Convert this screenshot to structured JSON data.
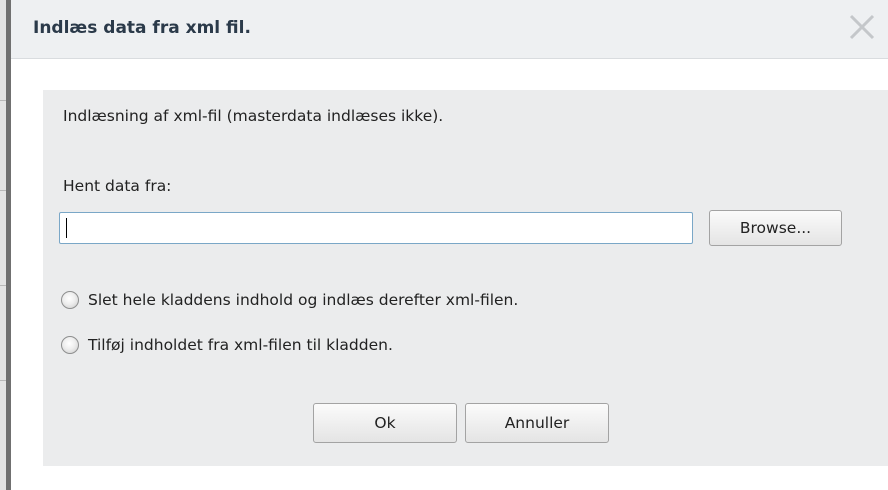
{
  "dialog": {
    "title": "Indlæs data fra xml fil.",
    "close_icon": "close-x-icon",
    "intro": "Indlæsning af xml-fil (masterdata indlæses ikke).",
    "file_label": "Hent data fra:",
    "file_input": {
      "value": "",
      "placeholder": ""
    },
    "browse_label": "Browse...",
    "options": [
      {
        "label": "Slet hele kladdens indhold og indlæs derefter xml-filen.",
        "selected": false
      },
      {
        "label": "Tilføj indholdet fra xml-filen til kladden.",
        "selected": false
      }
    ],
    "ok_label": "Ok",
    "cancel_label": "Annuller"
  },
  "colors": {
    "titlebar_bg": "#eef0f2",
    "title_text": "#2b3a4a",
    "body_bg": "#ebeced",
    "input_border": "#7aa7c7"
  }
}
